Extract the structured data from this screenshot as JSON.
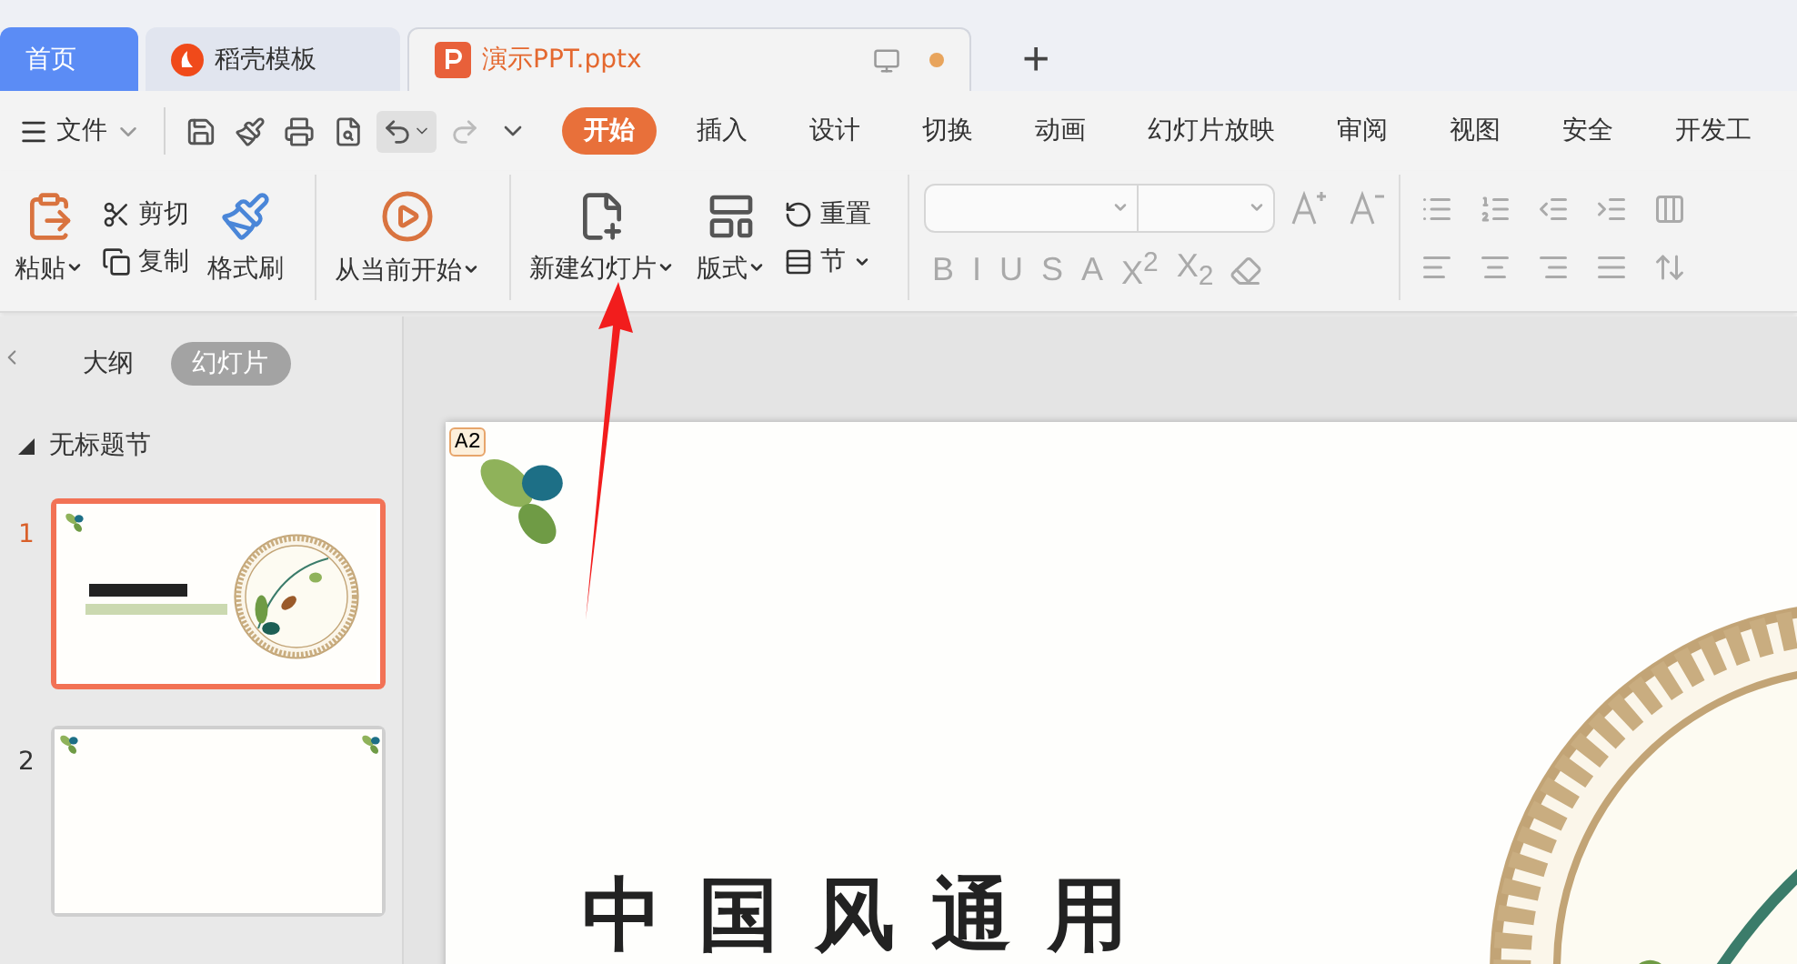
{
  "tabs": [
    {
      "label": "首页",
      "selected": false,
      "kind": "home"
    },
    {
      "label": "稻壳模板",
      "selected": false,
      "kind": "template"
    },
    {
      "label": "演示PPT.pptx",
      "selected": true,
      "kind": "document"
    }
  ],
  "new_tab": "+",
  "menu": {
    "file": "文件",
    "tabs": [
      {
        "label": "开始",
        "selected": true
      },
      {
        "label": "插入",
        "selected": false
      },
      {
        "label": "设计",
        "selected": false
      },
      {
        "label": "切换",
        "selected": false
      },
      {
        "label": "动画",
        "selected": false
      },
      {
        "label": "幻灯片放映",
        "selected": false
      },
      {
        "label": "审阅",
        "selected": false
      },
      {
        "label": "视图",
        "selected": false
      },
      {
        "label": "安全",
        "selected": false
      },
      {
        "label": "开发工",
        "selected": false
      }
    ]
  },
  "ribbon": {
    "paste": "粘贴",
    "cut": "剪切",
    "copy": "复制",
    "format_painter": "格式刷",
    "play_from_current": "从当前开始",
    "new_slide": "新建幻灯片",
    "layout": "版式",
    "reset": "重置",
    "section": "节",
    "font_buttons": [
      "B",
      "I",
      "U",
      "S",
      "A",
      "X$^{2}$",
      "X$_{2}$"
    ]
  },
  "panel": {
    "views": [
      {
        "label": "大纲",
        "selected": false
      },
      {
        "label": "幻灯片",
        "selected": true
      }
    ],
    "section": {
      "label": "无标题节",
      "expanded": true
    },
    "slides": [
      {
        "number": "1",
        "selected": true,
        "kind": "title"
      },
      {
        "number": "2",
        "selected": false,
        "kind": "blank"
      }
    ]
  },
  "slide": {
    "comment": "A2",
    "title": "中国风通用"
  }
}
